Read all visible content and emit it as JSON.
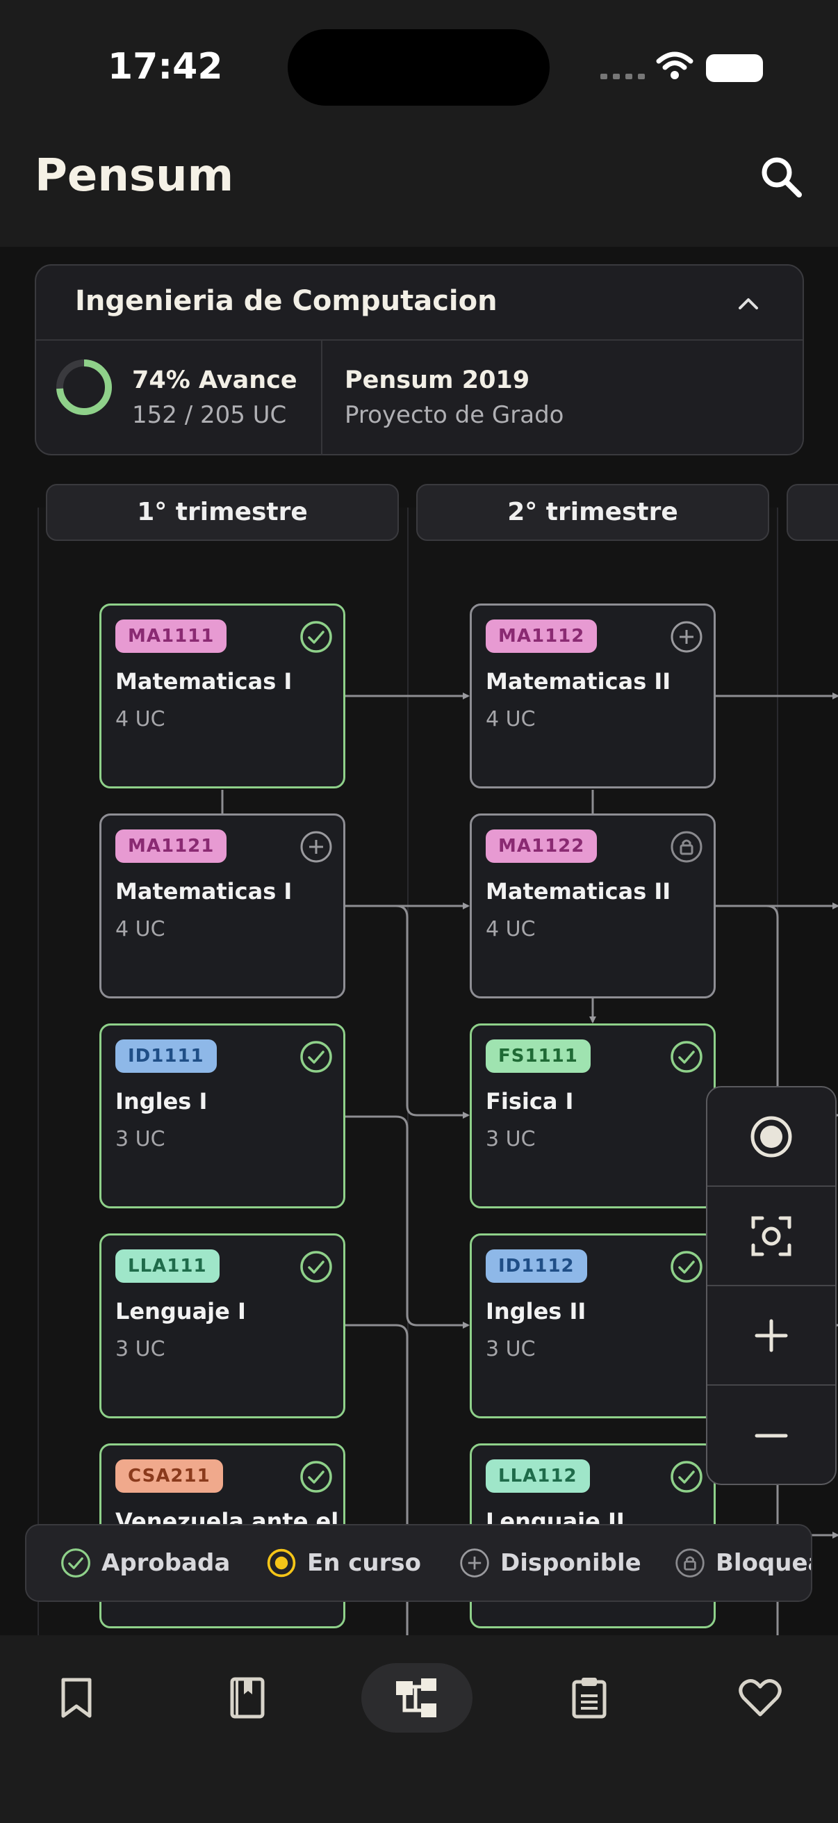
{
  "status_bar": {
    "time": "17:42"
  },
  "header": {
    "title": "Pensum"
  },
  "program": {
    "name": "Ingenieria de Computacion",
    "progress_pct": "74% Avance",
    "progress_uc": "152 / 205 UC",
    "progress_fraction": 0.74,
    "pensum_name": "Pensum 2019",
    "pensum_sub": "Proyecto de Grado"
  },
  "terms": [
    "1° trimestre",
    "2° trimestre"
  ],
  "courses": {
    "c1": {
      "code": "MA1111",
      "name": "Matematicas I",
      "uc": "4 UC",
      "status": "aprobada"
    },
    "c2": {
      "code": "MA1121",
      "name": "Matematicas I",
      "uc": "4 UC",
      "status": "disponible"
    },
    "c3": {
      "code": "ID1111",
      "name": "Ingles I",
      "uc": "3 UC",
      "status": "aprobada"
    },
    "c4": {
      "code": "LLA111",
      "name": "Lenguaje I",
      "uc": "3 UC",
      "status": "aprobada"
    },
    "c5": {
      "code": "CSA211",
      "name": "Venezuela ante el",
      "uc": "",
      "status": "aprobada"
    },
    "c6": {
      "code": "MA1112",
      "name": "Matematicas II",
      "uc": "4 UC",
      "status": "disponible"
    },
    "c7": {
      "code": "MA1122",
      "name": "Matematicas II",
      "uc": "4 UC",
      "status": "bloqueada"
    },
    "c8": {
      "code": "FS1111",
      "name": "Fisica I",
      "uc": "3 UC",
      "status": "aprobada"
    },
    "c9": {
      "code": "ID1112",
      "name": "Ingles II",
      "uc": "3 UC",
      "status": "aprobada"
    },
    "c10": {
      "code": "LLA112",
      "name": "Lenguaje II",
      "uc": "",
      "status": "aprobada"
    }
  },
  "legend": {
    "aprobada": "Aprobada",
    "en_curso": "En curso",
    "disponible": "Disponible",
    "bloqueada": "Bloqueada"
  },
  "colors": {
    "aprobada": "#8fd18a",
    "en_curso": "#f5c518",
    "math_chip": "#e79ad2",
    "english_chip": "#8eb8e8",
    "physics_chip": "#9fe3b0",
    "language_chip": "#9fe6c9",
    "social_chip": "#f0a98c"
  },
  "icons": {
    "nav": [
      "bookmark-icon",
      "book-icon",
      "tree-icon",
      "clipboard-icon",
      "heart-icon"
    ],
    "zoom": [
      "center-icon",
      "fit-icon",
      "plus-icon",
      "minus-icon"
    ]
  }
}
